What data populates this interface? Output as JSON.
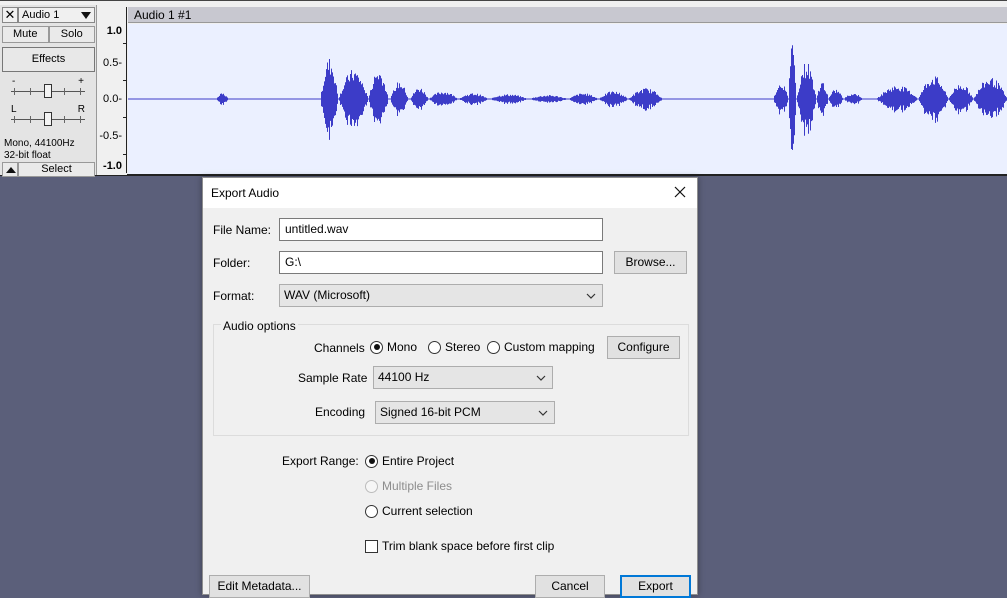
{
  "track": {
    "close_glyph": "✕",
    "name": "Audio 1",
    "mute_label": "Mute",
    "solo_label": "Solo",
    "effects_label": "Effects",
    "gain_minus": "-",
    "gain_plus": "+",
    "pan_left": "L",
    "pan_right": "R",
    "info_line1": "Mono, 44100Hz",
    "info_line2": "32-bit float",
    "select_label": "Select",
    "clip_name": "Audio 1 #1",
    "ruler_labels": [
      "1.0",
      "0.5-",
      "0.0-",
      "-0.5-",
      "-1.0"
    ],
    "waveform_color": "#3c3cc8"
  },
  "dialog": {
    "title": "Export Audio",
    "file_name_label": "File Name:",
    "file_name_value": "untitled.wav",
    "folder_label": "Folder:",
    "folder_value": "G:\\",
    "browse_label": "Browse...",
    "format_label": "Format:",
    "format_value": "WAV (Microsoft)",
    "audio_options_label": "Audio options",
    "channels_label": "Channels",
    "channel_mono": "Mono",
    "channel_stereo": "Stereo",
    "channel_custom": "Custom mapping",
    "configure_label": "Configure",
    "sample_rate_label": "Sample Rate",
    "sample_rate_value": "44100 Hz",
    "encoding_label": "Encoding",
    "encoding_value": "Signed 16-bit PCM",
    "export_range_label": "Export Range:",
    "range_entire": "Entire Project",
    "range_multiple": "Multiple Files",
    "range_current": "Current selection",
    "trim_label": "Trim blank space before first clip",
    "edit_metadata_label": "Edit Metadata...",
    "cancel_label": "Cancel",
    "export_label": "Export",
    "accent_color": "#0078d7"
  }
}
